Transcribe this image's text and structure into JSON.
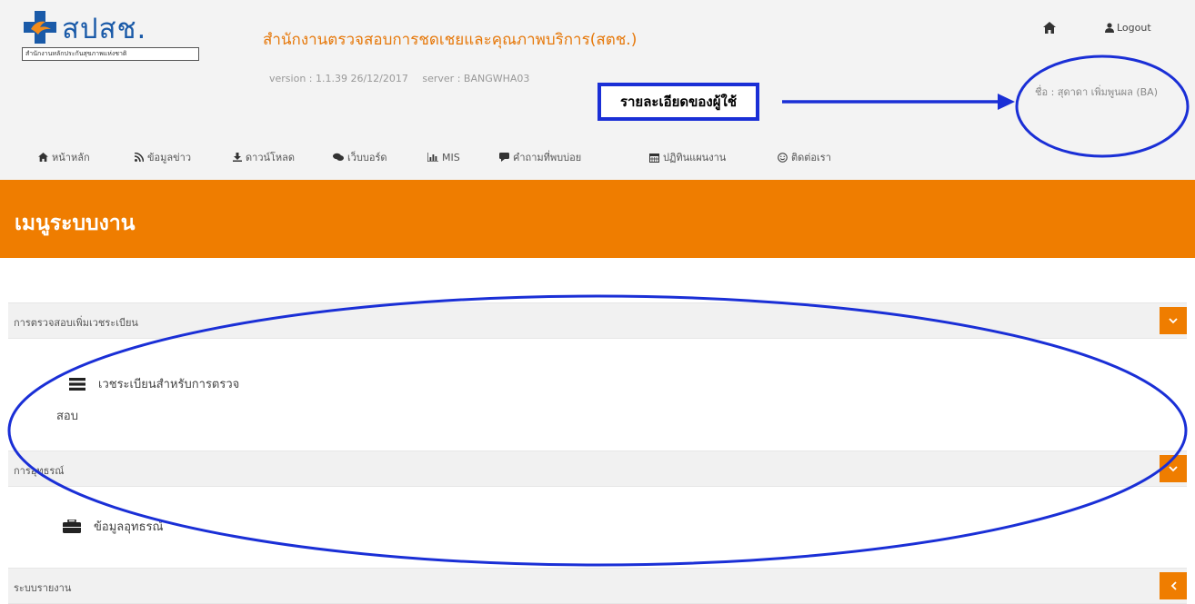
{
  "header": {
    "logo_text": "สปสช.",
    "logo_subtitle": "สำนักงานหลักประกันสุขภาพแห่งชาติ",
    "org_title": "สำนักงานตรวจสอบการชดเชยและคุณภาพบริการ(สตช.)",
    "version": "version : 1.1.39 26/12/2017",
    "server": "server : BANGWHA03",
    "logout_label": "Logout",
    "user_name": "ชื่อ : สุดาดา เพิ่มพูนผล (BA)"
  },
  "annotation": {
    "user_detail_label": "รายละเอียดของผู้ใช้"
  },
  "nav": {
    "items": [
      {
        "label": "หน้าหลัก",
        "icon": "home-icon"
      },
      {
        "label": "ข้อมูลข่าว",
        "icon": "rss-icon"
      },
      {
        "label": "ดาวน์โหลด",
        "icon": "download-icon"
      },
      {
        "label": "เว็บบอร์ด",
        "icon": "comments-icon"
      },
      {
        "label": "MIS",
        "icon": "bar-chart-icon"
      },
      {
        "label": "คำถามที่พบบ่อย",
        "icon": "comment-icon"
      },
      {
        "label": "ปฏิทินแผนงาน",
        "icon": "calendar-icon"
      },
      {
        "label": "ติดต่อเรา",
        "icon": "smile-icon"
      }
    ]
  },
  "page_title": "เมนูระบบงาน",
  "panels": [
    {
      "title": "การตรวจสอบเพิ่มเวชระเบียน",
      "item_line1": "เวชระเบียนสำหรับการตรวจ",
      "item_line2": "สอบ",
      "toggle": "chevron-down-icon"
    },
    {
      "title": "การอุทธรณ์",
      "item_line1": "ข้อมูลอุทธรณ์",
      "toggle": "chevron-down-icon"
    },
    {
      "title": "ระบบรายงาน",
      "toggle": "chevron-left-icon"
    }
  ],
  "colors": {
    "accent_orange": "#ef7d00",
    "brand_blue": "#1a5aa8",
    "annotation_blue": "#1a2fd6"
  }
}
